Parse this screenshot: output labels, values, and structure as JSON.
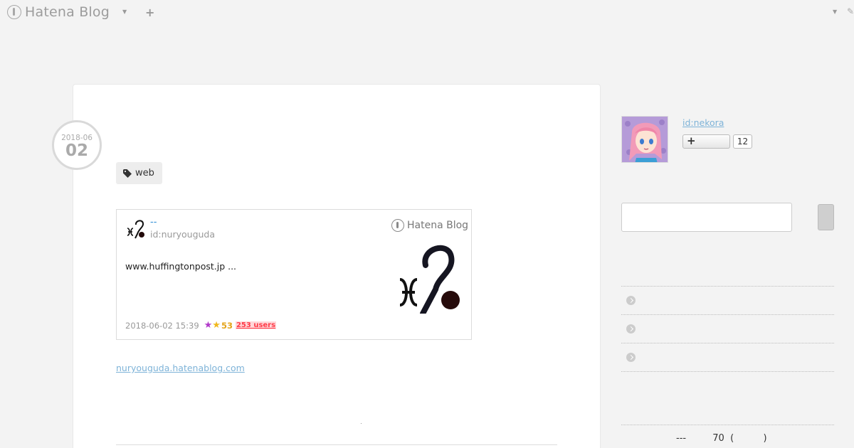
{
  "header": {
    "logo_text": "Hatena Blog"
  },
  "entry": {
    "date_year_month": "2018-06",
    "date_day": "02",
    "tag": "web",
    "embed": {
      "title": "--",
      "author": "id:nuryouguda",
      "service": "Hatena Blog",
      "description": "www.huffingtonpost.jp   ...",
      "timestamp": "2018-06-02 15:39",
      "star_count": "53",
      "bookmark_users": "253 users"
    },
    "blog_link": "nuryouguda.hatenablog.com"
  },
  "sidebar": {
    "profile_id": "id:nekora",
    "follower_count": "12",
    "archive_items": [
      "",
      "",
      ""
    ],
    "bottom_text": "---         70  (          )"
  },
  "colors": {
    "link": "#7eb3d8",
    "star_purple": "#b139c9",
    "star_yellow": "#f0b81e",
    "users_badge": "#ff3b48"
  }
}
